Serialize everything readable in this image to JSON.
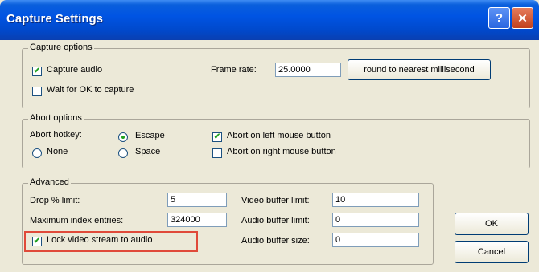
{
  "window": {
    "title": "Capture Settings",
    "help_label": "?",
    "close_label": "✕"
  },
  "capture_options": {
    "legend": "Capture options",
    "capture_audio": {
      "label": "Capture audio",
      "checked": true
    },
    "wait_for_ok": {
      "label": "Wait for OK to capture",
      "checked": false
    },
    "frame_rate": {
      "label": "Frame rate:",
      "value": "25.0000"
    },
    "round_button": "round to nearest millisecond"
  },
  "abort_options": {
    "legend": "Abort options",
    "hotkey_label": "Abort hotkey:",
    "hotkeys": [
      {
        "label": "None",
        "selected": false
      },
      {
        "label": "Escape",
        "selected": true
      },
      {
        "label": "Space",
        "selected": false
      }
    ],
    "abort_left": {
      "label": "Abort on left mouse button",
      "checked": true
    },
    "abort_right": {
      "label": "Abort on right mouse button",
      "checked": false
    }
  },
  "advanced": {
    "legend": "Advanced",
    "drop_limit": {
      "label": "Drop % limit:",
      "value": "5"
    },
    "max_index": {
      "label": "Maximum index entries:",
      "value": "324000"
    },
    "lock_video": {
      "label": "Lock video stream to audio",
      "checked": true
    },
    "video_buffer_limit": {
      "label": "Video buffer limit:",
      "value": "10"
    },
    "audio_buffer_limit": {
      "label": "Audio buffer limit:",
      "value": "0"
    },
    "audio_buffer_size": {
      "label": "Audio buffer size:",
      "value": "0"
    }
  },
  "buttons": {
    "ok": "OK",
    "cancel": "Cancel"
  },
  "colors": {
    "title_blue": "#0054e3",
    "highlight_red": "#e04a3a",
    "dialog_bg": "#ece9d8"
  },
  "icons": {
    "check": "✔"
  }
}
